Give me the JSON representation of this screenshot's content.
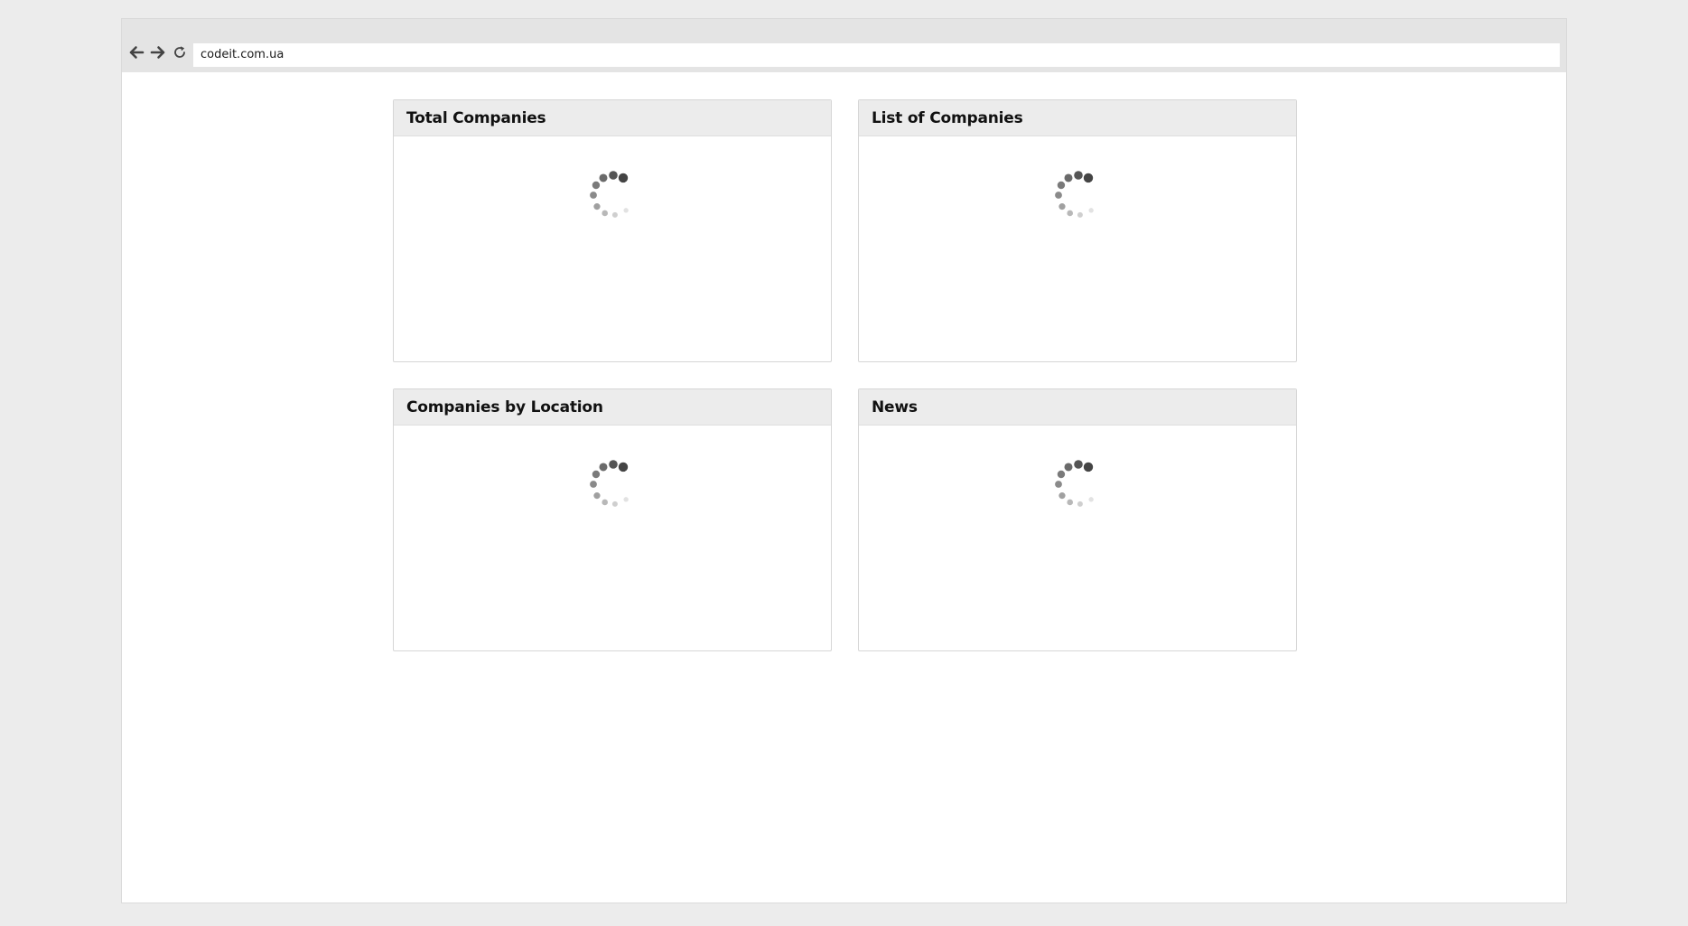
{
  "browser": {
    "url": "codeit.com.ua",
    "back_icon": "arrow-left-icon",
    "forward_icon": "arrow-right-icon",
    "reload_icon": "reload-icon"
  },
  "panels": [
    {
      "title": "Total Companies",
      "status_icon": "loading-spinner-icon"
    },
    {
      "title": "List of Companies",
      "status_icon": "loading-spinner-icon"
    },
    {
      "title": "Companies by Location",
      "status_icon": "loading-spinner-icon"
    },
    {
      "title": "News",
      "status_icon": "loading-spinner-icon"
    }
  ],
  "colors": {
    "page_background": "#ececec",
    "toolbar": "#e4e4e4",
    "panel_header": "#ececec",
    "spinner_dark": "#444444"
  }
}
